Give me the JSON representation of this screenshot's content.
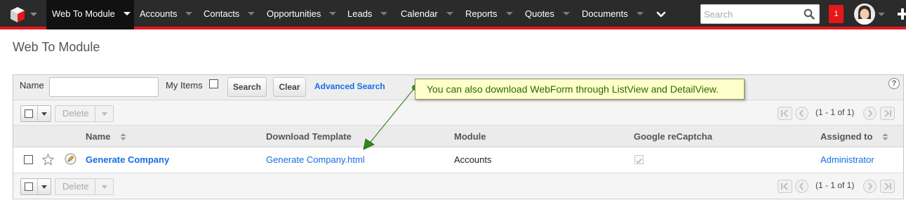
{
  "nav": {
    "items": [
      {
        "label": "Web To Module",
        "active": true
      },
      {
        "label": "Accounts"
      },
      {
        "label": "Contacts"
      },
      {
        "label": "Opportunities"
      },
      {
        "label": "Leads"
      },
      {
        "label": "Calendar"
      },
      {
        "label": "Reports"
      },
      {
        "label": "Quotes"
      },
      {
        "label": "Documents"
      }
    ],
    "search_placeholder": "Search",
    "notification_count": "1",
    "accent_color": "#e61718"
  },
  "page": {
    "title": "Web To Module"
  },
  "search_form": {
    "name_label": "Name",
    "name_value": "",
    "my_items_label": "My Items",
    "search_button": "Search",
    "clear_button": "Clear",
    "advanced_search_link": "Advanced Search"
  },
  "actions": {
    "delete_label": "Delete",
    "pagination_text": "(1 - 1 of 1)"
  },
  "table": {
    "columns": [
      "Name",
      "Download Template",
      "Module",
      "Google reCaptcha",
      "Assigned to"
    ],
    "rows": [
      {
        "name": "Generate Company",
        "download_template": "Generate Company.html",
        "module": "Accounts",
        "google_recaptcha": true,
        "assigned_to": "Administrator"
      }
    ]
  },
  "annotation": {
    "text": "You can also download WebForm through ListView and DetailView."
  }
}
